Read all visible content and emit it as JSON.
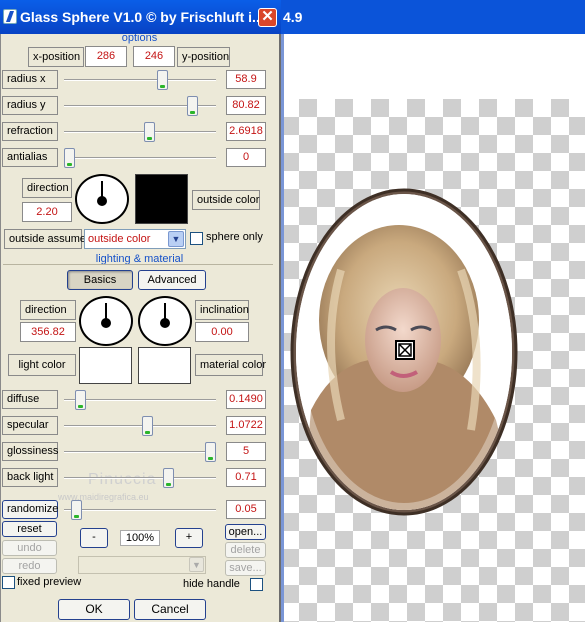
{
  "window": {
    "title": "Glass Sphere V1.0 © by Frischluft i...",
    "close_glyph": "✕",
    "preview_caption": "4.9"
  },
  "options": {
    "header": "options",
    "x_position_label": "x-position",
    "x_position_value": "286",
    "y_position_value": "246",
    "y_position_label": "y-position",
    "sliders": [
      {
        "label": "radius x",
        "value": "58.9",
        "level": 0.66
      },
      {
        "label": "radius y",
        "value": "80.82",
        "level": 0.87
      },
      {
        "label": "refraction",
        "value": "2.6918",
        "level": 0.57
      },
      {
        "label": "antialias",
        "value": "0",
        "level": 0.0
      }
    ],
    "direction_label": "direction",
    "direction_value": "2.20",
    "outside_color_label": "outside color",
    "outside_assume_label": "outside assume",
    "outside_assume_selected": "outside color",
    "sphere_only_label": "sphere only"
  },
  "lighting": {
    "header": "lighting & material",
    "tab_basics": "Basics",
    "tab_advanced": "Advanced",
    "direction_label": "direction",
    "direction_value": "356.82",
    "inclination_label": "inclination",
    "inclination_value": "0.00",
    "light_color_label": "light color",
    "material_color_label": "material color",
    "sliders": [
      {
        "label": "diffuse",
        "value": "0.1490",
        "level": 0.08
      },
      {
        "label": "specular",
        "value": "1.0722",
        "level": 0.55
      },
      {
        "label": "glossiness",
        "value": "5",
        "level": 1.0
      },
      {
        "label": "back light",
        "value": "0.71",
        "level": 0.7
      },
      {
        "label": "randomize",
        "value": "0.05",
        "level": 0.05
      }
    ]
  },
  "controls": {
    "reset": "reset",
    "undo": "undo",
    "redo": "redo",
    "zoom_minus": "-",
    "zoom_value": "100%",
    "zoom_plus": "+",
    "open": "open...",
    "delete": "delete",
    "save": "save...",
    "fixed_preview": "fixed preview",
    "hide_handle": "hide handle",
    "ok": "OK",
    "cancel": "Cancel"
  },
  "watermark": {
    "line1": "Pinuccia",
    "line2": "www.maidiregrafica.eu"
  },
  "colors": {
    "accent": "#1551c9",
    "value_text": "#c41414",
    "dialog_bg": "#ece9d8",
    "titlebar": "#0a5ee8",
    "outside_color_swatch": "#000000",
    "light_color_swatch": "#ffffff",
    "material_color_swatch": "#ffffff"
  }
}
